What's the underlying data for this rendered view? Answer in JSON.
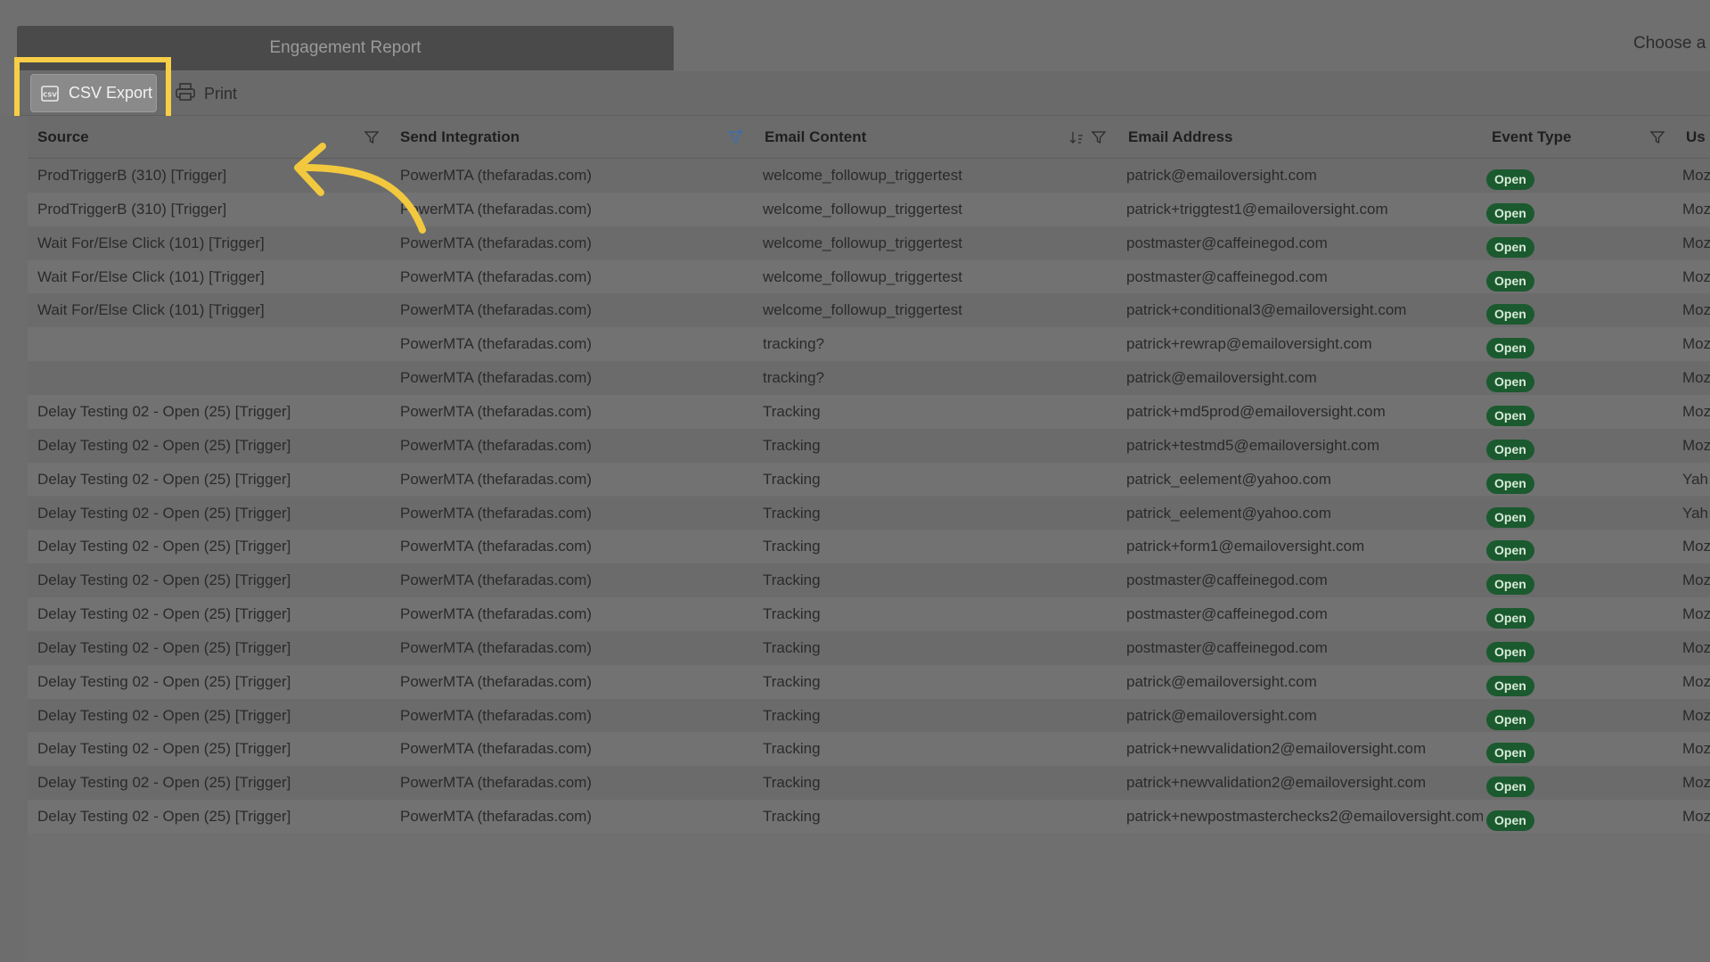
{
  "report_title": "Engagement Report",
  "choose_text": "Choose a p",
  "toolbar": {
    "csv_label": "CSV Export",
    "print_label": "Print"
  },
  "columns": {
    "source": "Source",
    "send_integration": "Send Integration",
    "email_content": "Email Content",
    "email_address": "Email Address",
    "event_type": "Event Type",
    "user_agent": "Us"
  },
  "rows": [
    {
      "source": "ProdTriggerB (310) [Trigger]",
      "send": "PowerMTA (thefaradas.com)",
      "content": "welcome_followup_triggertest",
      "email": "patrick@emailoversight.com",
      "event": "Open",
      "user": "Moz"
    },
    {
      "source": "ProdTriggerB (310) [Trigger]",
      "send": "PowerMTA (thefaradas.com)",
      "content": "welcome_followup_triggertest",
      "email": "patrick+triggtest1@emailoversight.com",
      "event": "Open",
      "user": "Moz"
    },
    {
      "source": "Wait For/Else Click (101) [Trigger]",
      "send": "PowerMTA (thefaradas.com)",
      "content": "welcome_followup_triggertest",
      "email": "postmaster@caffeinegod.com",
      "event": "Open",
      "user": "Moz"
    },
    {
      "source": "Wait For/Else Click (101) [Trigger]",
      "send": "PowerMTA (thefaradas.com)",
      "content": "welcome_followup_triggertest",
      "email": "postmaster@caffeinegod.com",
      "event": "Open",
      "user": "Moz"
    },
    {
      "source": "Wait For/Else Click (101) [Trigger]",
      "send": "PowerMTA (thefaradas.com)",
      "content": "welcome_followup_triggertest",
      "email": "patrick+conditional3@emailoversight.com",
      "event": "Open",
      "user": "Moz"
    },
    {
      "source": "",
      "send": "PowerMTA (thefaradas.com)",
      "content": "tracking?",
      "email": "patrick+rewrap@emailoversight.com",
      "event": "Open",
      "user": "Moz"
    },
    {
      "source": "",
      "send": "PowerMTA (thefaradas.com)",
      "content": "tracking?",
      "email": "patrick@emailoversight.com",
      "event": "Open",
      "user": "Moz"
    },
    {
      "source": "Delay Testing 02 - Open (25) [Trigger]",
      "send": "PowerMTA (thefaradas.com)",
      "content": "Tracking",
      "email": "patrick+md5prod@emailoversight.com",
      "event": "Open",
      "user": "Moz"
    },
    {
      "source": "Delay Testing 02 - Open (25) [Trigger]",
      "send": "PowerMTA (thefaradas.com)",
      "content": "Tracking",
      "email": "patrick+testmd5@emailoversight.com",
      "event": "Open",
      "user": "Moz"
    },
    {
      "source": "Delay Testing 02 - Open (25) [Trigger]",
      "send": "PowerMTA (thefaradas.com)",
      "content": "Tracking",
      "email": "patrick_eelement@yahoo.com",
      "event": "Open",
      "user": "Yah"
    },
    {
      "source": "Delay Testing 02 - Open (25) [Trigger]",
      "send": "PowerMTA (thefaradas.com)",
      "content": "Tracking",
      "email": "patrick_eelement@yahoo.com",
      "event": "Open",
      "user": "Yah"
    },
    {
      "source": "Delay Testing 02 - Open (25) [Trigger]",
      "send": "PowerMTA (thefaradas.com)",
      "content": "Tracking",
      "email": "patrick+form1@emailoversight.com",
      "event": "Open",
      "user": "Moz"
    },
    {
      "source": "Delay Testing 02 - Open (25) [Trigger]",
      "send": "PowerMTA (thefaradas.com)",
      "content": "Tracking",
      "email": "postmaster@caffeinegod.com",
      "event": "Open",
      "user": "Moz"
    },
    {
      "source": "Delay Testing 02 - Open (25) [Trigger]",
      "send": "PowerMTA (thefaradas.com)",
      "content": "Tracking",
      "email": "postmaster@caffeinegod.com",
      "event": "Open",
      "user": "Moz"
    },
    {
      "source": "Delay Testing 02 - Open (25) [Trigger]",
      "send": "PowerMTA (thefaradas.com)",
      "content": "Tracking",
      "email": "postmaster@caffeinegod.com",
      "event": "Open",
      "user": "Moz"
    },
    {
      "source": "Delay Testing 02 - Open (25) [Trigger]",
      "send": "PowerMTA (thefaradas.com)",
      "content": "Tracking",
      "email": "patrick@emailoversight.com",
      "event": "Open",
      "user": "Moz"
    },
    {
      "source": "Delay Testing 02 - Open (25) [Trigger]",
      "send": "PowerMTA (thefaradas.com)",
      "content": "Tracking",
      "email": "patrick@emailoversight.com",
      "event": "Open",
      "user": "Moz"
    },
    {
      "source": "Delay Testing 02 - Open (25) [Trigger]",
      "send": "PowerMTA (thefaradas.com)",
      "content": "Tracking",
      "email": "patrick+newvalidation2@emailoversight.com",
      "event": "Open",
      "user": "Moz"
    },
    {
      "source": "Delay Testing 02 - Open (25) [Trigger]",
      "send": "PowerMTA (thefaradas.com)",
      "content": "Tracking",
      "email": "patrick+newvalidation2@emailoversight.com",
      "event": "Open",
      "user": "Moz"
    },
    {
      "source": "Delay Testing 02 - Open (25) [Trigger]",
      "send": "PowerMTA (thefaradas.com)",
      "content": "Tracking",
      "email": "patrick+newpostmasterchecks2@emailoversight.com",
      "event": "Open",
      "user": "Moz"
    }
  ],
  "colors": {
    "highlight": "#f7ce46",
    "badge_bg": "#1a5a2e",
    "filter_active": "#3d6fa8"
  },
  "icons": {
    "csv": "csv-file-icon",
    "print": "printer-icon",
    "filter": "filter-icon",
    "sort": "sort-icon",
    "pointer": "curved-arrow-icon"
  }
}
